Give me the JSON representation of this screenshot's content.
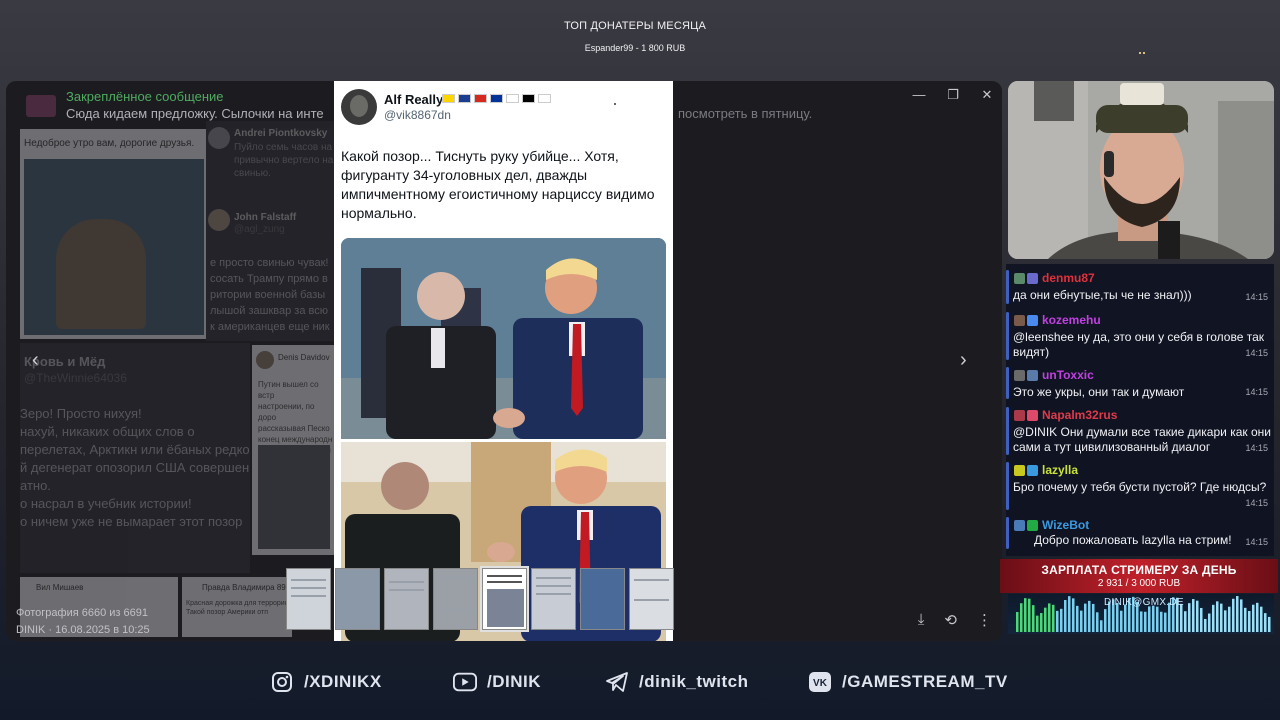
{
  "top_donors": {
    "title": "ТОП ДОНАТЕРЫ МЕСЯЦА",
    "entry": "Espander99 - 1 800 RUB"
  },
  "viewer": {
    "pinned_title": "Закреплённое сообщение",
    "pinned_text": "Сюда кидаем предложку. Сылочки на инте",
    "pinned_text_right": "посмотреть в пятницу.",
    "photo_counter": "Фотография 6660 из 6691",
    "photo_meta": "DINIK · 16.08.2025 в 10:25",
    "background_posts": {
      "post1_caption": "Недоброе утро вам, дорогие друзья.",
      "post2_author": "Andrei Piontkovsky",
      "post2_text": [
        "Пуйло семь часов на",
        "привычно вертело на",
        "свинью."
      ],
      "post3_author": "John Falstaff",
      "post3_handle": "@agl_zung",
      "post3_text": [
        "е просто свинью чувак!",
        "сосать Трампу прямо в",
        "ритории военной базы",
        "лышой зашквар за всю",
        "к американцев еще ник"
      ],
      "post4_author": "Кровь и Мёд",
      "post4_handle": "@TheWinnie64036",
      "post4_text": [
        "Зеро! Просто нихуя!",
        "нахуй, никаких общих слов о",
        "перелетах, Арктикн или ёбаных редко",
        "й дегенерат опозорил США совершен",
        "атно.",
        "о насрал в учебник истории!",
        "о ничем уже не вымарает этот позор"
      ],
      "post5_author": "Denis Davidov",
      "post5_text": [
        "Путин вышел со встр",
        "настроении, по доро",
        "рассказывая Песко",
        "конец международн",
        "кровавого преступн"
      ],
      "post6_author": "Вил Мишаев",
      "post7_author": "Правда Владимира 89",
      "post7_text": [
        "Красная дорожка для террорист",
        "Такой позор Америки отп"
      ]
    }
  },
  "tweet": {
    "name": "Alf Really",
    "handle": "@vik8867dn",
    "text": "Какой позор... Тиснуть руку убийце... Хотя, фигуранту 34-уголовных дел, дважды импичментному егоистичному  нарциссу видимо нормально.",
    "flags": [
      "#ffd500",
      "#1a3d8f",
      "#d52b1e",
      "#003399",
      "#ffffff",
      "#000000",
      "#ffffff"
    ]
  },
  "chat": [
    {
      "nick": "denmu87",
      "color": "#e0303a",
      "text": "да они ебнутые,ты че не знал)))",
      "time": "14:15"
    },
    {
      "nick": "kozemehu",
      "color": "#c040e0",
      "text": "@leenshee ну да, это они у себя в голове так видят)",
      "time": "14:15"
    },
    {
      "nick": "unToxxic",
      "color": "#c040e0",
      "text": "Это же укры, они так и думают",
      "time": "14:15"
    },
    {
      "nick": "Napalm32rus",
      "color": "#e03a4a",
      "text": "@DINIK Они думали все такие дикари как они сами а тут цивилизованный диалог",
      "time": "14:15"
    },
    {
      "nick": "lazylla",
      "color": "#c8e03a",
      "text": "Бро почему у тебя бусти пустой? Где нюдсы?",
      "time": "14:15"
    },
    {
      "nick": "WizeBot",
      "color": "#3a9ae0",
      "text": "Добро пожаловать lazylla на стрим!",
      "time": "14:15"
    }
  ],
  "salary": {
    "title": "ЗАРПЛАТА СТРИМЕРУ ЗА ДЕНЬ",
    "value": "2 931 / 3 000 RUB",
    "progress": 0.977
  },
  "equalizer": {
    "email": "DINIK@GMX.DE"
  },
  "socials": [
    {
      "icon": "instagram-icon",
      "label": "/XDINIKX"
    },
    {
      "icon": "youtube-icon",
      "label": "/DINIK"
    },
    {
      "icon": "telegram-icon",
      "label": "/dinik_twitch"
    },
    {
      "icon": "vk-icon",
      "label": "/GAMESTREAM_TV"
    }
  ]
}
